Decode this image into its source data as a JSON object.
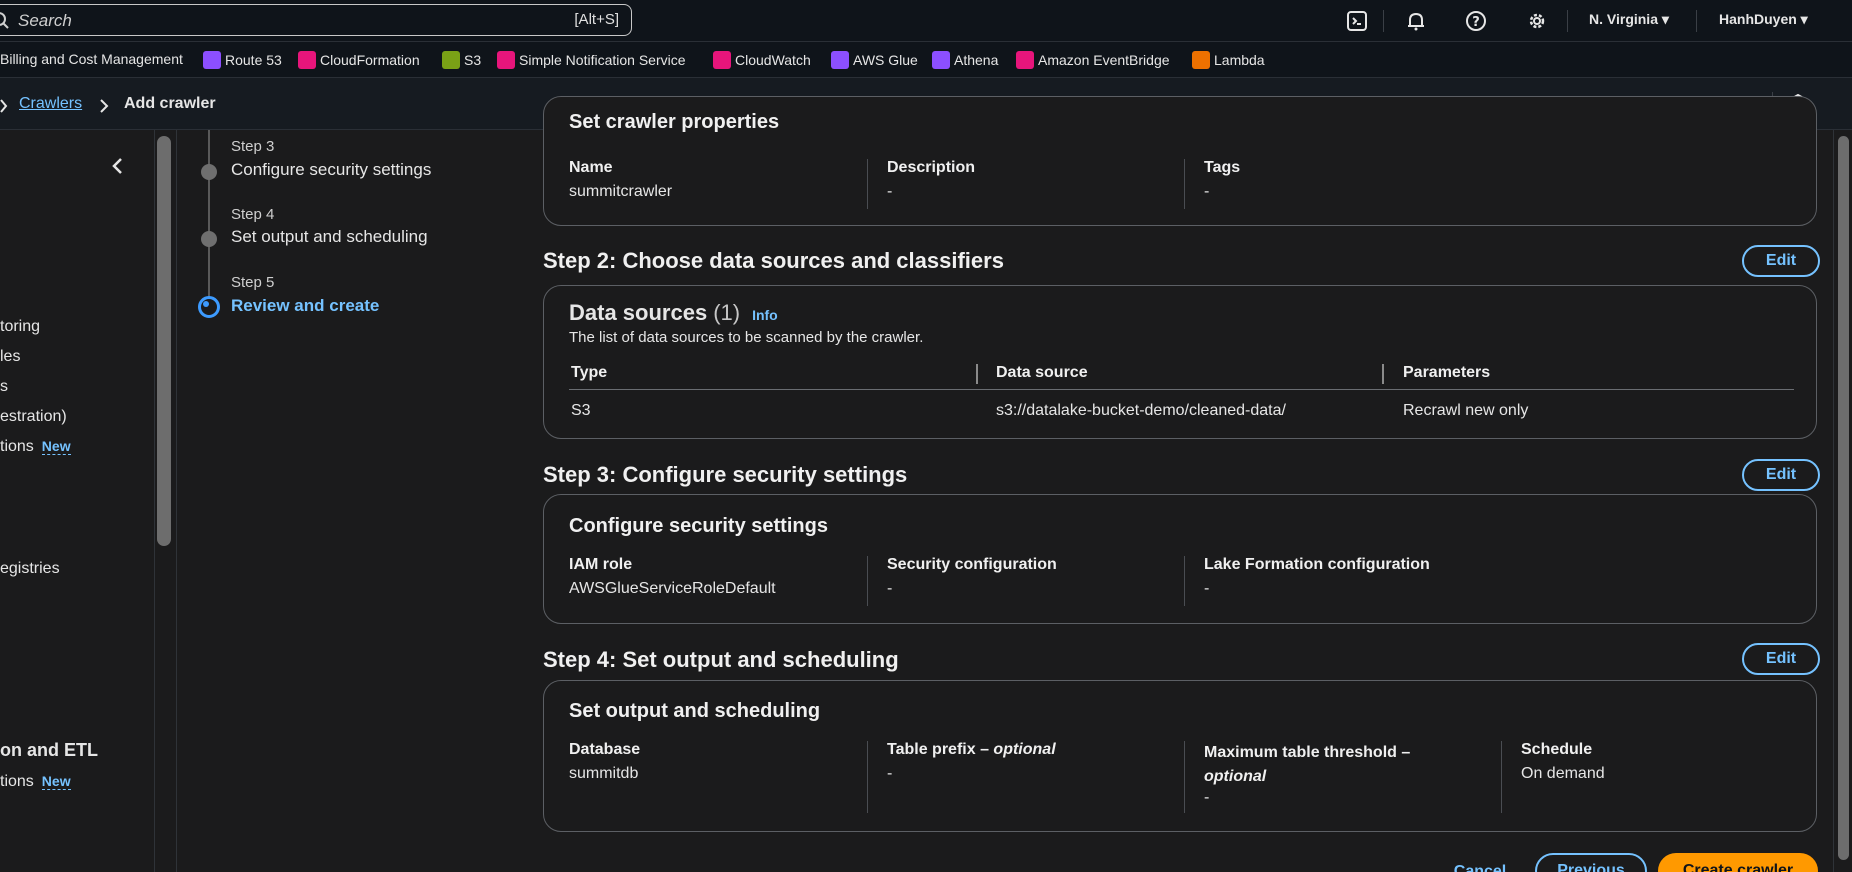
{
  "topnav": {
    "search_placeholder": "Search",
    "search_shortcut": "[Alt+S]",
    "region": "N. Virginia ▾",
    "user": "HanhDuyen ▾"
  },
  "favorites": [
    {
      "label": "Billing and Cost Management",
      "color": ""
    },
    {
      "label": "Route 53",
      "color": "#8c4fff"
    },
    {
      "label": "CloudFormation",
      "color": "#e7157b"
    },
    {
      "label": "S3",
      "color": "#7aa116"
    },
    {
      "label": "Simple Notification Service",
      "color": "#e7157b"
    },
    {
      "label": "CloudWatch",
      "color": "#e7157b"
    },
    {
      "label": "AWS Glue",
      "color": "#8c4fff"
    },
    {
      "label": "Athena",
      "color": "#8c4fff"
    },
    {
      "label": "Amazon EventBridge",
      "color": "#e7157b"
    },
    {
      "label": "Lambda",
      "color": "#ed7100"
    }
  ],
  "breadcrumb": {
    "link": "Crawlers",
    "current": "Add crawler"
  },
  "sidenav": {
    "items": [
      "toring",
      "les",
      "s",
      "estration)",
      "tions",
      "egistries",
      "on and ETL",
      "tions"
    ],
    "new_tag": "New"
  },
  "steps": [
    {
      "label": "Step 3",
      "name": "Configure security settings"
    },
    {
      "label": "Step 4",
      "name": "Set output and scheduling"
    },
    {
      "label": "Step 5",
      "name": "Review and create"
    }
  ],
  "step1": {
    "cut_title": "Set crawler properties",
    "fields": [
      {
        "key": "Name",
        "value": "summitcrawler"
      },
      {
        "key": "Description",
        "value": "-"
      },
      {
        "key": "Tags",
        "value": "-"
      }
    ]
  },
  "step2": {
    "title": "Step 2: Choose data sources and classifiers",
    "edit": "Edit",
    "card_title": "Data sources",
    "count": "(1)",
    "info": "Info",
    "description": "The list of data sources to be scanned by the crawler.",
    "columns": [
      "Type",
      "Data source",
      "Parameters"
    ],
    "rows": [
      [
        "S3",
        "s3://datalake-bucket-demo/cleaned-data/",
        "Recrawl new only"
      ]
    ]
  },
  "step3": {
    "title": "Step 3: Configure security settings",
    "edit": "Edit",
    "card_title": "Configure security settings",
    "fields": [
      {
        "key": "IAM role",
        "value": "AWSGlueServiceRoleDefault"
      },
      {
        "key": "Security configuration",
        "value": "-"
      },
      {
        "key": "Lake Formation configuration",
        "value": "-"
      }
    ]
  },
  "step4": {
    "title": "Step 4: Set output and scheduling",
    "edit": "Edit",
    "card_title": "Set output and scheduling",
    "fields": [
      {
        "key": "Database",
        "value": "summitdb"
      },
      {
        "key": "Table prefix",
        "optional": "optional",
        "value": "-"
      },
      {
        "key": "Maximum table threshold",
        "optional": "optional",
        "value": "-"
      },
      {
        "key": "Schedule",
        "value": "On demand"
      }
    ]
  },
  "footer": {
    "cancel": "Cancel",
    "previous": "Previous",
    "create": "Create crawler"
  }
}
